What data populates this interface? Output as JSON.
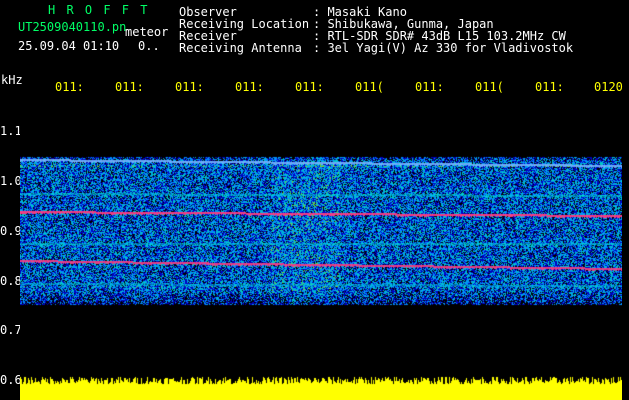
{
  "header": {
    "title": "H R O F F T",
    "filename": "UT2509040110.pn",
    "type": "meteor",
    "datetime": "25.09.04 01:10",
    "count": "0..",
    "fields": [
      {
        "label": "Observer",
        "value": ": Masaki Kano"
      },
      {
        "label": "Receiving Location",
        "value": ": Shibukawa, Gunma, Japan"
      },
      {
        "label": "Receiver",
        "value": ": RTL-SDR SDR# 43dB L15 103.2MHz CW"
      },
      {
        "label": "Receiving Antenna",
        "value": ": 3el Yagi(V) Az 330 for Vladivostok"
      }
    ]
  },
  "axis": {
    "unit": "kHz",
    "freq_ticks": [
      "1.1",
      "1.0",
      "0.9",
      "0.8",
      "0.7",
      "0.6"
    ],
    "time_ticks": [
      "011:",
      "011:",
      "011:",
      "011:",
      "011:",
      "011(",
      "011:",
      "011(",
      "011:",
      "0120"
    ]
  },
  "colors": {
    "header_title": "#00ff66",
    "axis_text": "#ffff00",
    "noise_bar": "#ffff00",
    "band_line": "#ff3366"
  }
}
